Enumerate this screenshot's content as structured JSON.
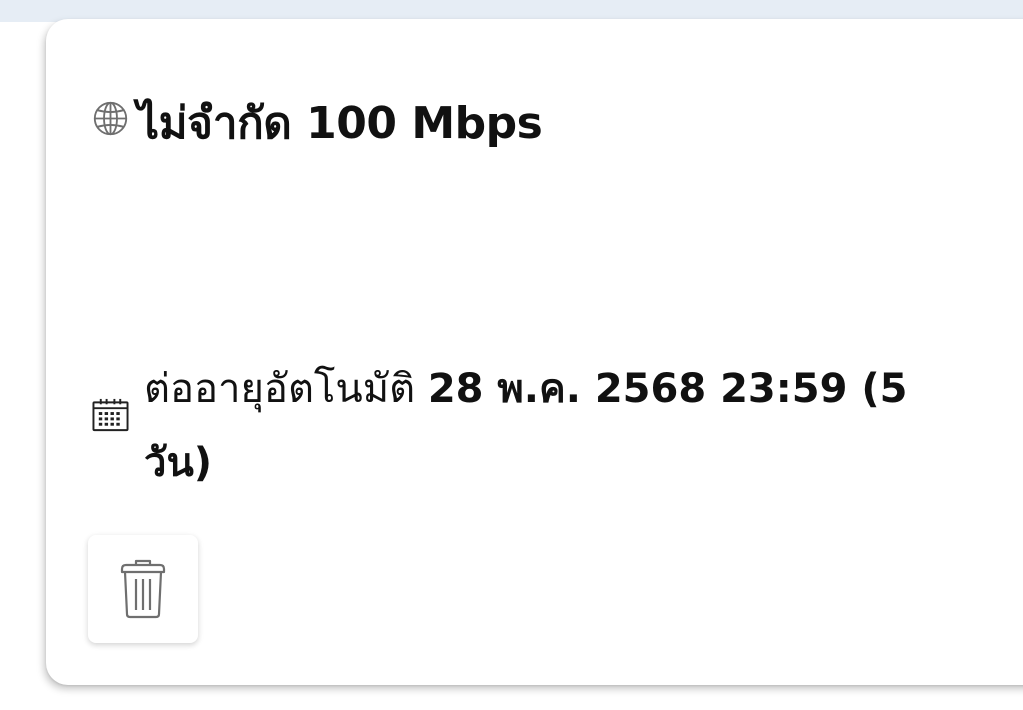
{
  "plan": {
    "icon": "globe-icon",
    "label": "ไม่จำกัด 100 Mbps"
  },
  "renewal": {
    "icon": "calendar-icon",
    "label": "ต่ออายุอัตโนมัติ",
    "value": "28 พ.ค. 2568 23:59 (5 วัน)"
  },
  "actions": {
    "delete_icon": "trash-icon"
  }
}
